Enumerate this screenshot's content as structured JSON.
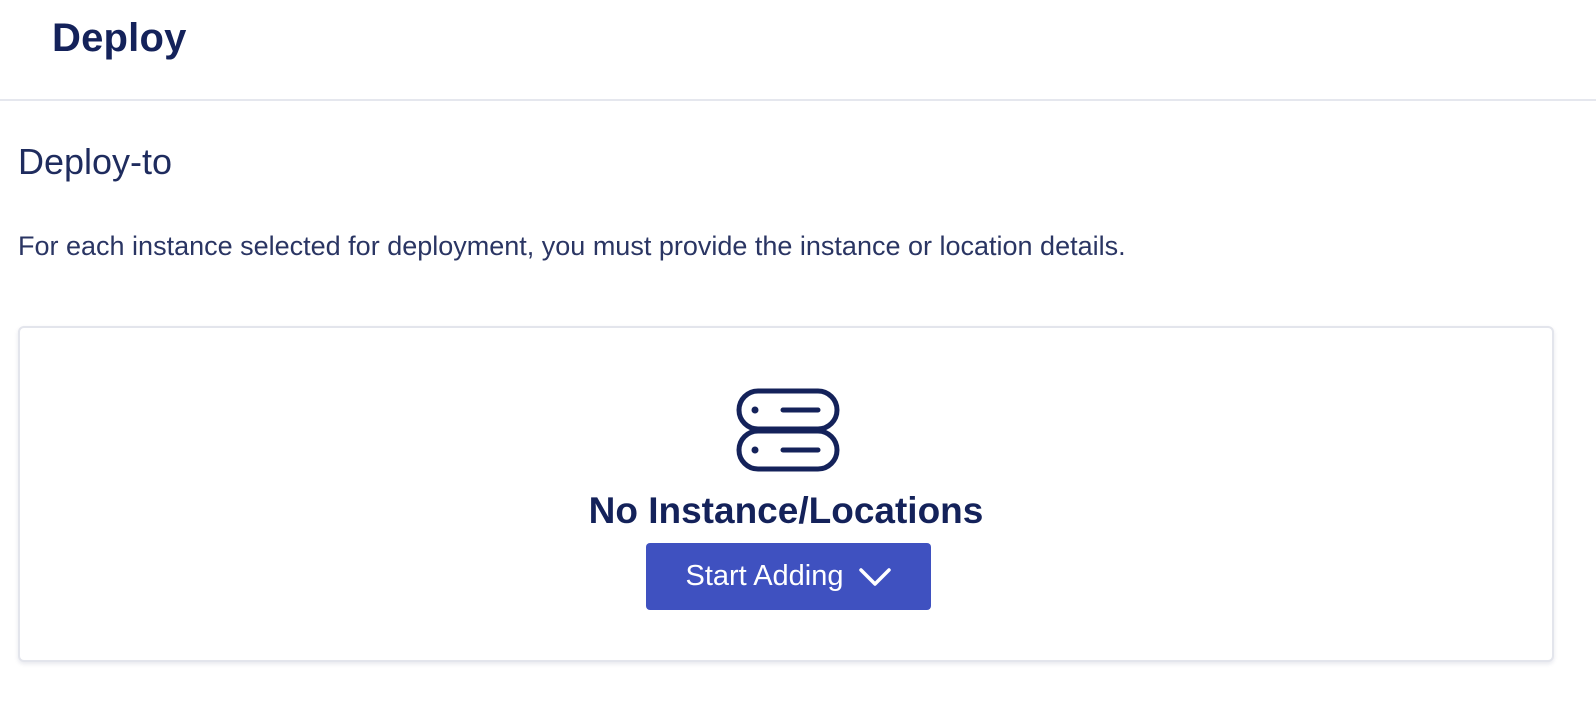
{
  "header": {
    "title": "Deploy"
  },
  "section": {
    "title": "Deploy-to",
    "description": "For each instance selected for deployment, you must provide the instance or location details."
  },
  "empty_state": {
    "icon": "server-stack-icon",
    "title": "No Instance/Locations",
    "button_label": "Start Adding",
    "button_icon": "chevron-down-icon"
  },
  "colors": {
    "primary_text": "#14225a",
    "button_bg": "#3f51c0",
    "border": "#e3e5ec"
  }
}
